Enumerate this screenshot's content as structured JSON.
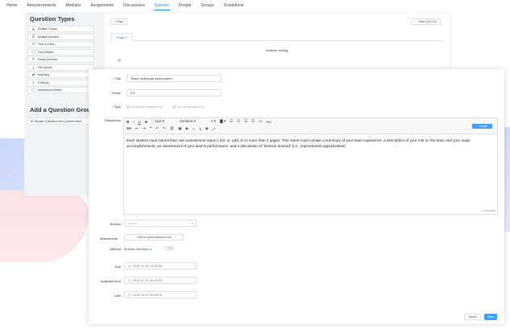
{
  "nav": [
    "Home",
    "Announcements",
    "Modules",
    "Assignments",
    "Discussions",
    "Quizzes",
    "People",
    "Groups",
    "Gradebook"
  ],
  "nav_active_index": 5,
  "question_types": {
    "title": "Question Types",
    "items": [
      {
        "icon": "●",
        "label": "Multiple Choice"
      },
      {
        "icon": "☰",
        "label": "Multiple Answers"
      },
      {
        "icon": "✕",
        "label": "True or False"
      },
      {
        "icon": "▢",
        "label": "Fill in Blanks"
      },
      {
        "icon": "✎",
        "label": "Essay Question"
      },
      {
        "icon": "⤓",
        "label": "File Upload"
      },
      {
        "icon": "⇄",
        "label": "Matching"
      },
      {
        "icon": "≡",
        "label": "Ordering"
      },
      {
        "icon": "▢",
        "label": "Numberical Answer"
      }
    ]
  },
  "question_group": {
    "title": "Add a Question Group",
    "item": "Random Questions from Question Bank"
  },
  "bg": {
    "page_btn": "+ Page",
    "back_btn": "← Back Quiz List",
    "tab": "Page 1",
    "quiz_title": "midterm testing",
    "q": "11"
  },
  "form": {
    "title_label": "Title",
    "title_value": "Team: Individual Assessment",
    "points_label": "Points",
    "points_value": "2.0",
    "type_label": "Type",
    "type_opt1": "Individual Assignment",
    "type_opt2": "Group Assignment",
    "desc_label": "Description",
    "font_size": "11pt",
    "font_name": "Verdana",
    "image_btn": "+ Image",
    "description": "Each student must submit their own assessment report (.doc or .pdf) of no more than 2 pages.  This report must contain a summary of your team experience, a description of your role on the team and your major accomplishments, an assessment of your team's performance, and a discussion of \"lessons learned\" (i.e., improvement opportunities).",
    "word_count": "65 WORDS",
    "rubrics_label": "Rubrics",
    "rubrics_placeholder": "Select",
    "attachments_label": "Attachments",
    "attach_btn": "Click to upload attachments",
    "attempt_label": "Attempt",
    "attempt_text": "Multiple Attempts",
    "due_label": "Due",
    "due_value": "2019-11-30 15:00:00",
    "available_label": "Available from",
    "available_value": "2019-11-21 00:00:00",
    "until_label": "Until",
    "until_value": "2019-12-07 00:00:00",
    "cancel": "Cancel",
    "save": "Save"
  },
  "colors": {
    "accent": "#409eff",
    "required": "#e53935"
  }
}
